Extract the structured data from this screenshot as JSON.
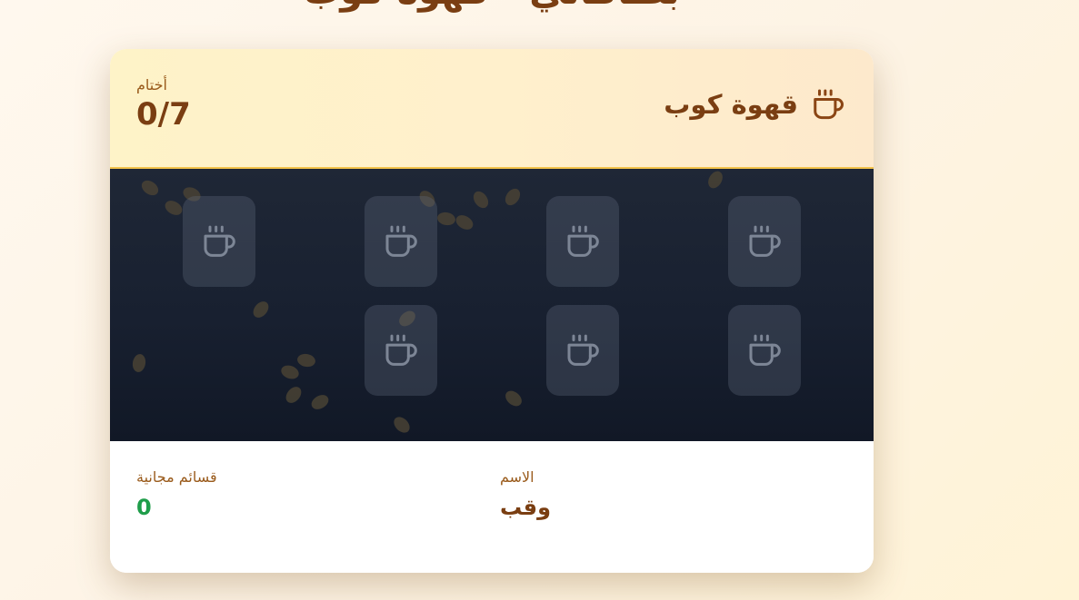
{
  "page": {
    "title": "بطاقاتي - قهوة كوب"
  },
  "card": {
    "brand_name": "قهوة كوب",
    "brand_icon": "coffee-cup-icon",
    "stamps_label": "أختام",
    "stamps_count": "0/7",
    "stamp_slots": [
      {
        "filled": false
      },
      {
        "filled": false
      },
      {
        "filled": false
      },
      {
        "filled": false
      },
      {
        "filled": false
      },
      {
        "filled": false
      },
      {
        "filled": false
      }
    ],
    "fields": {
      "name_label": "الاسم",
      "name_value": "وقب",
      "vouchers_label": "قسائم مجانية",
      "vouchers_value": "0"
    }
  },
  "colors": {
    "brand_brown": "#7a3e12",
    "label_brown": "#9a5b1c",
    "voucher_green": "#1f9d4a",
    "header_border": "#f2c24a",
    "stamp_area_dark": "#1a2130"
  }
}
